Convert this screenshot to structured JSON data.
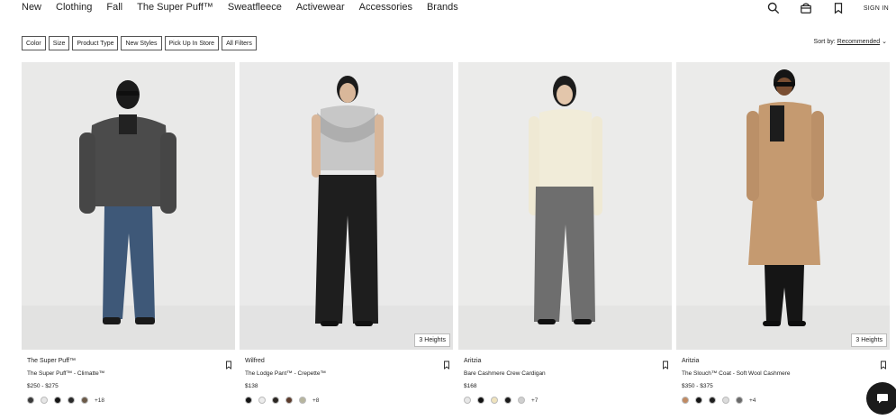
{
  "nav": {
    "links": [
      "New",
      "Clothing",
      "Fall",
      "The Super Puff™",
      "Sweatfleece",
      "Activewear",
      "Accessories",
      "Brands"
    ],
    "icons": [
      "search-icon",
      "bag-icon",
      "bookmark-icon"
    ],
    "sign_in": "SIGN IN"
  },
  "filters": {
    "buttons": [
      "Color",
      "Size",
      "Product Type",
      "New Styles",
      "Pick Up In Store",
      "All Filters"
    ],
    "sort_label": "Sort by:",
    "sort_value": "Recommended",
    "sort_chevron": "⌄"
  },
  "products": [
    {
      "brand": "The Super Puff™",
      "name": "The Super Puff™ - Climatte™",
      "price": "$250 - $275",
      "badge": "",
      "swatches": [
        "#3a3a3a",
        "#e6e6e6",
        "#151515",
        "#2a2a2a",
        "#6b5a48"
      ],
      "more": "+18",
      "bg": "#e9e9e8"
    },
    {
      "brand": "Wilfred",
      "name": "The Lodge Pant™ - Crepette™",
      "price": "$138",
      "badge": "3 Heights",
      "swatches": [
        "#141414",
        "#ececec",
        "#2b2622",
        "#5b3a2b",
        "#b7b59e"
      ],
      "more": "+8",
      "bg": "#eaeaea"
    },
    {
      "brand": "Aritzia",
      "name": "Bare Cashmere Crew Cardigan",
      "price": "$168",
      "badge": "",
      "swatches": [
        "#e7e7e7",
        "#111111",
        "#efe3bd",
        "#1a1a1a",
        "#cfcfcf"
      ],
      "more": "+7",
      "bg": "#ebebea"
    },
    {
      "brand": "Aritzia",
      "name": "The Slouch™ Coat - Soft Wool Cashmere",
      "price": "$350 - $375",
      "badge": "3 Heights",
      "swatches": [
        "#c08a62",
        "#141414",
        "#1f1f1f",
        "#dcdcdc",
        "#6a6a6a"
      ],
      "more": "+4",
      "bg": "#ebebea"
    }
  ]
}
